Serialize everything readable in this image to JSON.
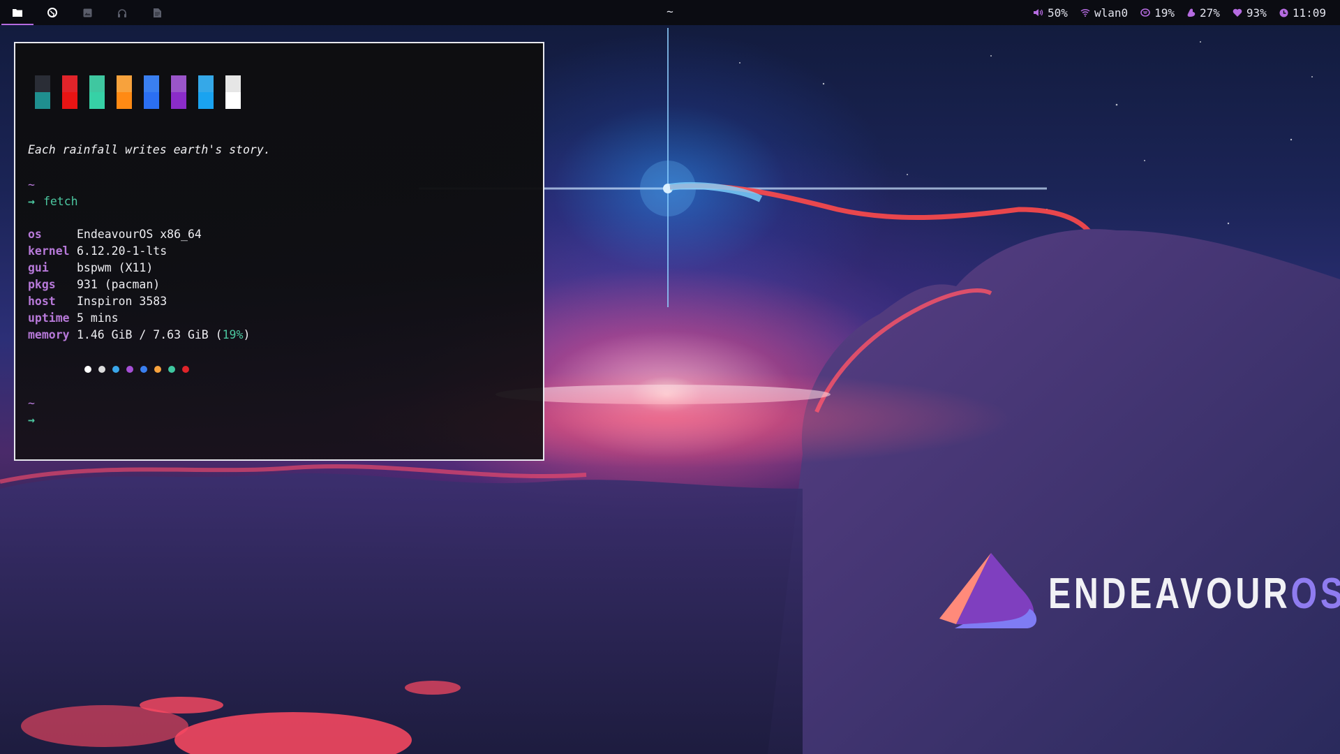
{
  "topbar": {
    "workspaces": [
      {
        "icon": "folder-icon",
        "active": true
      },
      {
        "icon": "globe-icon",
        "active": false
      },
      {
        "icon": "image-icon",
        "active": false
      },
      {
        "icon": "headphones-icon",
        "active": false
      },
      {
        "icon": "document-icon",
        "active": false
      }
    ],
    "center_title": "~",
    "modules": {
      "volume": {
        "icon": "volume-icon",
        "value": "50%"
      },
      "network": {
        "icon": "wifi-icon",
        "value": "wlan0"
      },
      "cpu": {
        "icon": "cpu-icon",
        "value": "19%"
      },
      "memory": {
        "icon": "memory-icon",
        "value": "27%"
      },
      "battery": {
        "icon": "heart-icon",
        "value": "93%"
      },
      "clock": {
        "icon": "clock-icon",
        "value": "11:09"
      }
    },
    "accent_color": "#b56be0"
  },
  "terminal": {
    "color_swatches": [
      {
        "top": "#2a2d36",
        "bottom": "#1f8f8f"
      },
      {
        "top": "#e0242a",
        "bottom": "#e81414"
      },
      {
        "top": "#3fc7a0",
        "bottom": "#36d1a6"
      },
      {
        "top": "#f7a23d",
        "bottom": "#ff8a14"
      },
      {
        "top": "#3a7ff0",
        "bottom": "#2b6ff2"
      },
      {
        "top": "#9a55c9",
        "bottom": "#8b2cc9"
      },
      {
        "top": "#35a8e8",
        "bottom": "#1aa3f0"
      },
      {
        "top": "#e6e6e6",
        "bottom": "#ffffff"
      }
    ],
    "quote": "Each rainfall writes earth's story.",
    "prompt_dir": "~",
    "prompt_arrow": "→",
    "command": "fetch",
    "info": [
      {
        "key": "os",
        "value": "EndeavourOS x86_64"
      },
      {
        "key": "kernel",
        "value": "6.12.20-1-lts"
      },
      {
        "key": "gui",
        "value": "bspwm (X11)"
      },
      {
        "key": "pkgs",
        "value": "931 (pacman)"
      },
      {
        "key": "host",
        "value": "Inspiron 3583"
      },
      {
        "key": "uptime",
        "value": "5 mins"
      },
      {
        "key": "memory",
        "value": "1.46 GiB / 7.63 GiB (",
        "highlight": "19%",
        "suffix": ")"
      }
    ],
    "dot_colors": [
      "#ffffff",
      "#dcdcdc",
      "#3aa6ea",
      "#a64fd6",
      "#3a7ff0",
      "#f7a23d",
      "#3fc7a0",
      "#e0242a"
    ],
    "prompt2_dir": "~",
    "prompt2_arrow": "→"
  },
  "logo": {
    "text_main": "ENDEAVOUR",
    "text_accent": "OS"
  }
}
